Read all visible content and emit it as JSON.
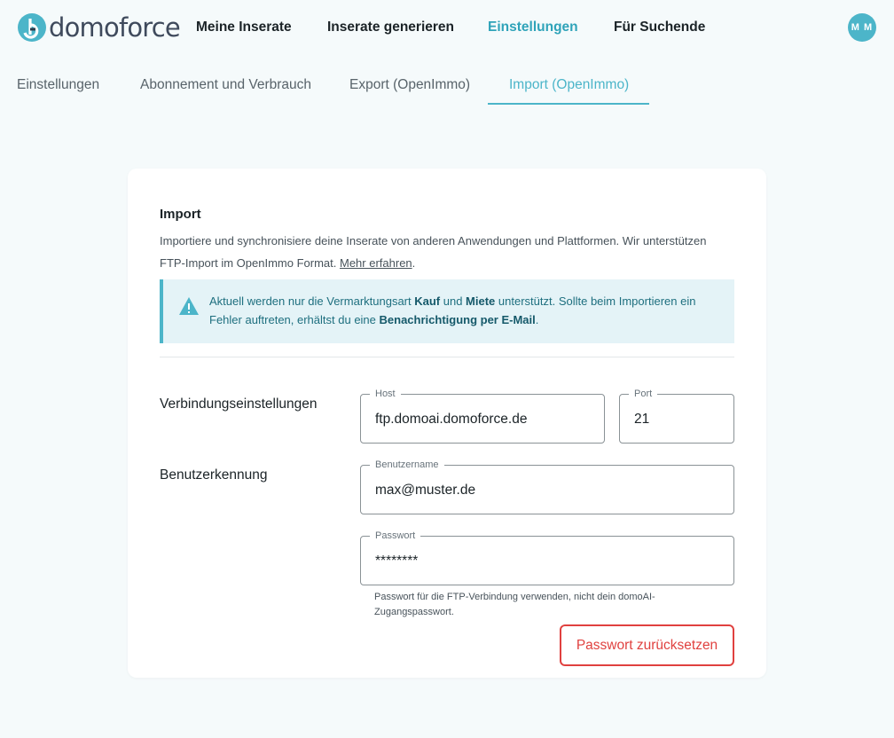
{
  "brand": {
    "name": "domoforce",
    "accent": "#4cb5c9",
    "danger": "#e0413f"
  },
  "topnav": {
    "items": [
      {
        "label": "Meine Inserate"
      },
      {
        "label": "Inserate generieren"
      },
      {
        "label": "Einstellungen",
        "active": true
      },
      {
        "label": "Für Suchende"
      }
    ],
    "avatar_initials": "M M"
  },
  "subtabs": [
    {
      "label": "Einstellungen"
    },
    {
      "label": "Abonnement und Verbrauch"
    },
    {
      "label": "Export (OpenImmo)"
    },
    {
      "label": "Import (OpenImmo)",
      "active": true
    }
  ],
  "import": {
    "title": "Import",
    "description": "Importiere und synchronisiere deine Inserate von anderen Anwendungen und Plattformen. Wir unterstützen FTP-Import im OpenImmo Format.",
    "learn_more": "Mehr erfahren",
    "alert": {
      "icon": "warning-icon",
      "t1": "Aktuell werden nur die Vermarktungsart ",
      "b1": "Kauf",
      "t2": " und ",
      "b2": "Miete",
      "t3": " unterstützt. Sollte beim Importieren ein Fehler auftreten, erhältst du eine ",
      "b3": "Benachrichtigung per E-Mail",
      "t4": "."
    },
    "connection": {
      "label": "Verbindungseinstellungen",
      "host_label": "Host",
      "host_value": "ftp.domoai.domoforce.de",
      "port_label": "Port",
      "port_value": "21"
    },
    "credentials": {
      "label": "Benutzerkennung",
      "username_label": "Benutzername",
      "username_value": "max@muster.de",
      "password_label": "Passwort",
      "password_value": "********",
      "password_helper": "Passwort für die FTP-Verbindung verwenden, nicht dein domoAI-Zugangspasswort."
    },
    "reset_button": "Passwort zurücksetzen"
  }
}
